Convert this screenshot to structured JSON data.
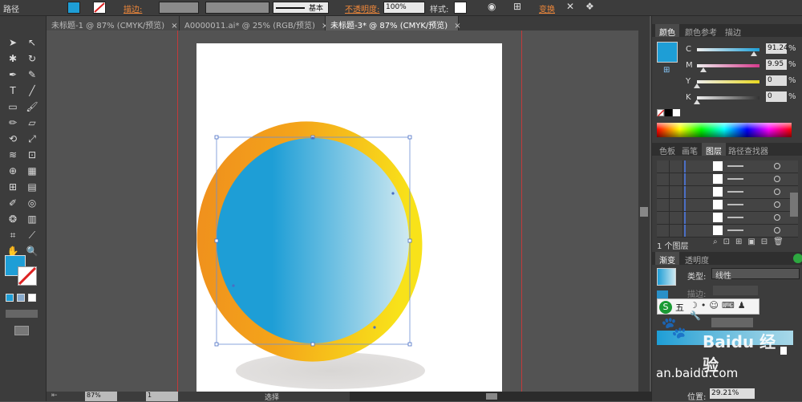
{
  "control_bar": {
    "object_type": "路径",
    "stroke_label": "描边:",
    "stroke_profile": "基本",
    "opacity_label": "不透明度:",
    "opacity_value": "100%",
    "style_label": "样式:",
    "transform_label": "变换"
  },
  "tabs": [
    {
      "label": "未标题-1 @ 87% (CMYK/预览)",
      "close": "×"
    },
    {
      "label": "A0000011.ai* @ 25% (RGB/预览)",
      "close": "×"
    },
    {
      "label": "未标题-3* @ 87% (CMYK/预览)",
      "close": "×"
    }
  ],
  "color_panel": {
    "tabs": [
      "颜色",
      "颜色参考",
      "描边"
    ],
    "channels": [
      {
        "name": "C",
        "value": "91.24",
        "unit": "%",
        "pos": 0.91,
        "color": "#1ea0d8"
      },
      {
        "name": "M",
        "value": "9.95",
        "unit": "%",
        "pos": 0.1,
        "color": "#d63a8c"
      },
      {
        "name": "Y",
        "value": "0",
        "unit": "%",
        "pos": 0.0,
        "color": "#e8d820"
      },
      {
        "name": "K",
        "value": "0",
        "unit": "%",
        "pos": 0.0,
        "color": "#333333"
      }
    ]
  },
  "layers_panel": {
    "tabs": [
      "色板",
      "画笔",
      "图层",
      "路径查找器"
    ],
    "status": "1 个图层"
  },
  "gradient_panel": {
    "tabs": [
      "渐变",
      "透明度"
    ],
    "type_label": "类型:",
    "type_value": "线性",
    "stroke_label": "描边:",
    "position_label": "位置:",
    "position_value": "29.21%"
  },
  "ime_bar": {
    "text": "五"
  },
  "watermark": {
    "brand": "Baidu 经验",
    "url": "an.baidu.com"
  },
  "status_bar": {
    "zoom": "87%",
    "page": "1",
    "mode": "选择"
  },
  "colors": {
    "fill": "#1e9ed6",
    "gradient_blue": "#1e9ed6",
    "gradient_light": "#cfe9f1",
    "gradient_orange": "#ee8a1e",
    "gradient_yellow": "#f8df1a"
  }
}
